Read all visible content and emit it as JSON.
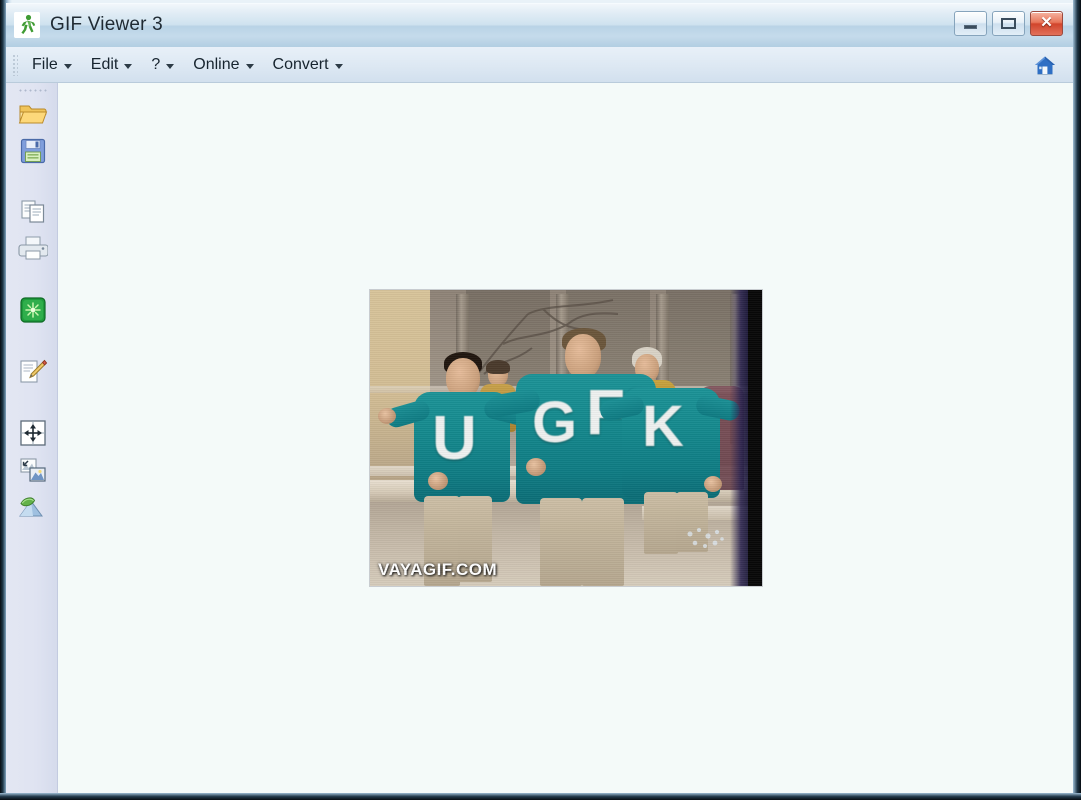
{
  "window": {
    "title": "GIF Viewer 3",
    "app_icon": "running-man-icon",
    "controls": {
      "minimize": "minimize-button",
      "maximize": "maximize-button",
      "close_label": "✕"
    }
  },
  "menubar": {
    "items": [
      {
        "label": "File",
        "has_caret": true
      },
      {
        "label": "Edit",
        "has_caret": true
      },
      {
        "label": "?",
        "has_caret": true
      },
      {
        "label": "Online",
        "has_caret": true
      },
      {
        "label": "Convert",
        "has_caret": true
      }
    ],
    "home_icon": "home-icon"
  },
  "toolbar": {
    "buttons": [
      {
        "name": "open-folder-icon",
        "title": "Open"
      },
      {
        "name": "save-floppy-icon",
        "title": "Save"
      },
      {
        "name": "copy-pages-icon",
        "title": "Copy"
      },
      {
        "name": "print-icon",
        "title": "Print"
      },
      {
        "name": "green-effect-icon",
        "title": "Effects"
      },
      {
        "name": "edit-pencil-icon",
        "title": "Edit"
      },
      {
        "name": "resize-arrows-icon",
        "title": "Resize"
      },
      {
        "name": "image-export-icon",
        "title": "Export image"
      },
      {
        "name": "optimize-icon",
        "title": "Optimize"
      }
    ]
  },
  "image": {
    "watermark": "VAYAGIF.COM",
    "sweater_color": "#158a8e",
    "pants_color": "#c2b49b",
    "letters": [
      "U",
      "G",
      "F",
      "K"
    ],
    "description_alt": "people in teal sweaters with white letters"
  },
  "colors": {
    "titlebar_top": "#f2f7fb",
    "titlebar_bottom": "#b2cee2",
    "menubar": "#dde8f3",
    "toolbar": "#dfe3f1",
    "canvas": "#f4faf9",
    "accent_close": "#d1452c"
  }
}
